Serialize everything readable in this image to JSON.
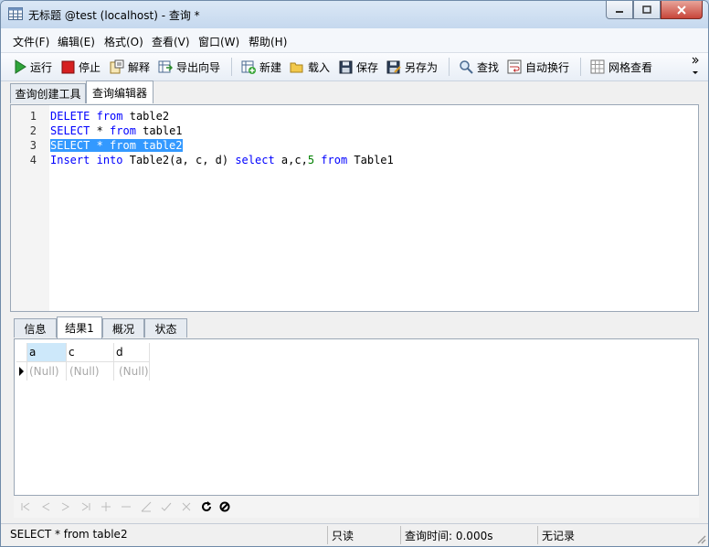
{
  "window": {
    "title": "无标题 @test (localhost) - 查询 *"
  },
  "menu": [
    "文件(F)",
    "编辑(E)",
    "格式(O)",
    "查看(V)",
    "窗口(W)",
    "帮助(H)"
  ],
  "toolbar": {
    "run": "运行",
    "stop": "停止",
    "explain": "解释",
    "export_wizard": "导出向导",
    "new": "新建",
    "load": "载入",
    "save": "保存",
    "save_as": "另存为",
    "find": "查找",
    "word_wrap": "自动换行",
    "grid_view": "网格查看"
  },
  "tabs": [
    "查询创建工具",
    "查询编辑器"
  ],
  "editor": {
    "lines": [
      {
        "num": "1",
        "tokens": [
          {
            "t": "DELETE",
            "k": "kw"
          },
          {
            "t": " "
          },
          {
            "t": "from",
            "k": "kw"
          },
          {
            "t": " table2"
          }
        ]
      },
      {
        "num": "2",
        "tokens": [
          {
            "t": "SELECT",
            "k": "kw"
          },
          {
            "t": " * "
          },
          {
            "t": "from",
            "k": "kw"
          },
          {
            "t": " table1"
          }
        ]
      },
      {
        "num": "3",
        "tokens": [
          {
            "t": "SELECT * from table2",
            "k": "sel"
          }
        ]
      },
      {
        "num": "4",
        "tokens": [
          {
            "t": "Insert",
            "k": "kw"
          },
          {
            "t": " "
          },
          {
            "t": "into",
            "k": "kw"
          },
          {
            "t": " Table2(a, c, d) "
          },
          {
            "t": "select",
            "k": "kw"
          },
          {
            "t": " a,c,"
          },
          {
            "t": "5",
            "k": "num"
          },
          {
            "t": " "
          },
          {
            "t": "from",
            "k": "kw"
          },
          {
            "t": " Table1"
          }
        ]
      }
    ]
  },
  "result_tabs": [
    "信息",
    "结果1",
    "概况",
    "状态"
  ],
  "grid": {
    "columns": [
      "a",
      "c",
      "d"
    ],
    "row": [
      "(Null)",
      "(Null)",
      "(Null)"
    ]
  },
  "status": {
    "sql": "SELECT * from table2",
    "mode": "只读",
    "time": "查询时间: 0.000s",
    "records": "无记录"
  }
}
